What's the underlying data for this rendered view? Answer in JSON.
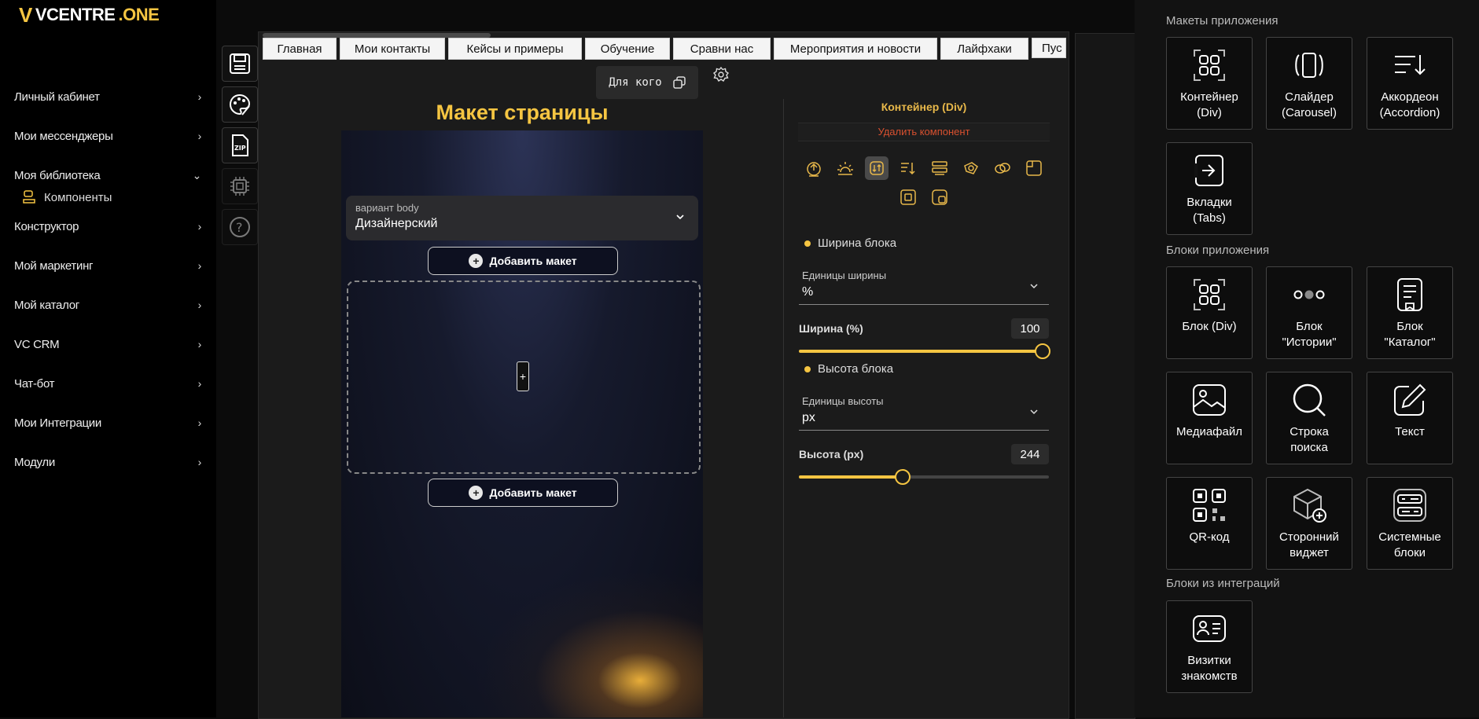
{
  "logo": {
    "brand": "VCENTRE",
    "suffix": ".ONE"
  },
  "sidebar": {
    "items": [
      {
        "label": "Личный кабинет"
      },
      {
        "label": "Мои мессенджеры"
      },
      {
        "label": "Моя библиотека"
      },
      {
        "label": "Конструктор"
      },
      {
        "label": "Мой маркетинг"
      },
      {
        "label": "Мой каталог"
      },
      {
        "label": "VC CRM"
      },
      {
        "label": "Чат-бот"
      },
      {
        "label": "Мои Интеграции"
      },
      {
        "label": "Модули"
      }
    ],
    "sub_item": "Компоненты"
  },
  "tabs": [
    "Главная",
    "Мои контакты",
    "Кейсы и примеры",
    "Обучение",
    "Сравни нас",
    "Мероприятия и новости",
    "Лайфхаки",
    "Пус"
  ],
  "for_whom": "Для кого",
  "page_title": "Макет страницы",
  "body_variant": {
    "label": "вариант body",
    "value": "Дизайнерский"
  },
  "add_layout_label": "Добавить макет",
  "drop_plus": "+",
  "properties": {
    "title": "Контейнер (Div)",
    "delete": "Удалить компонент",
    "width_block": "Ширина блока",
    "width_units_label": "Единицы ширины",
    "width_units_value": "%",
    "width_label": "Ширина (%)",
    "width_value": "100",
    "width_min": 0,
    "width_max": 100,
    "height_block": "Высота блока",
    "height_units_label": "Единицы высоты",
    "height_units_value": "px",
    "height_label": "Высота (px)",
    "height_value": "244",
    "height_fraction": 0.41
  },
  "right_panel": {
    "app_layouts_title": "Макеты приложения",
    "app_layouts": [
      {
        "label": "Контейнер\n(Div)",
        "icon": "grid-icon"
      },
      {
        "label": "Слайдер\n(Carousel)",
        "icon": "carousel-icon"
      },
      {
        "label": "Аккордеон\n(Accordion)",
        "icon": "accordion-icon"
      },
      {
        "label": "Вкладки\n(Tabs)",
        "icon": "tabs-icon"
      }
    ],
    "app_blocks_title": "Блоки приложения",
    "app_blocks": [
      {
        "label": "Блок (Div)",
        "icon": "grid-icon"
      },
      {
        "label": "Блок\n\"Истории\"",
        "icon": "stories-icon"
      },
      {
        "label": "Блок\n\"Каталог\"",
        "icon": "catalog-icon"
      },
      {
        "label": "Медиафайл",
        "icon": "image-icon"
      },
      {
        "label": "Строка\nпоиска",
        "icon": "search-icon"
      },
      {
        "label": "Текст",
        "icon": "pencil-icon"
      },
      {
        "label": "QR-код",
        "icon": "qr-icon"
      },
      {
        "label": "Сторонний\nвиджет",
        "icon": "widget-icon"
      },
      {
        "label": "Системные\nблоки",
        "icon": "system-icon"
      }
    ],
    "integration_blocks_title": "Блоки из интеграций",
    "integration_blocks": [
      {
        "label": "Визитки\nзнакомств",
        "icon": "business-card-icon"
      }
    ]
  },
  "colors": {
    "accent": "#f5c542",
    "danger": "#d8502f",
    "background": "#0b0b0b"
  }
}
